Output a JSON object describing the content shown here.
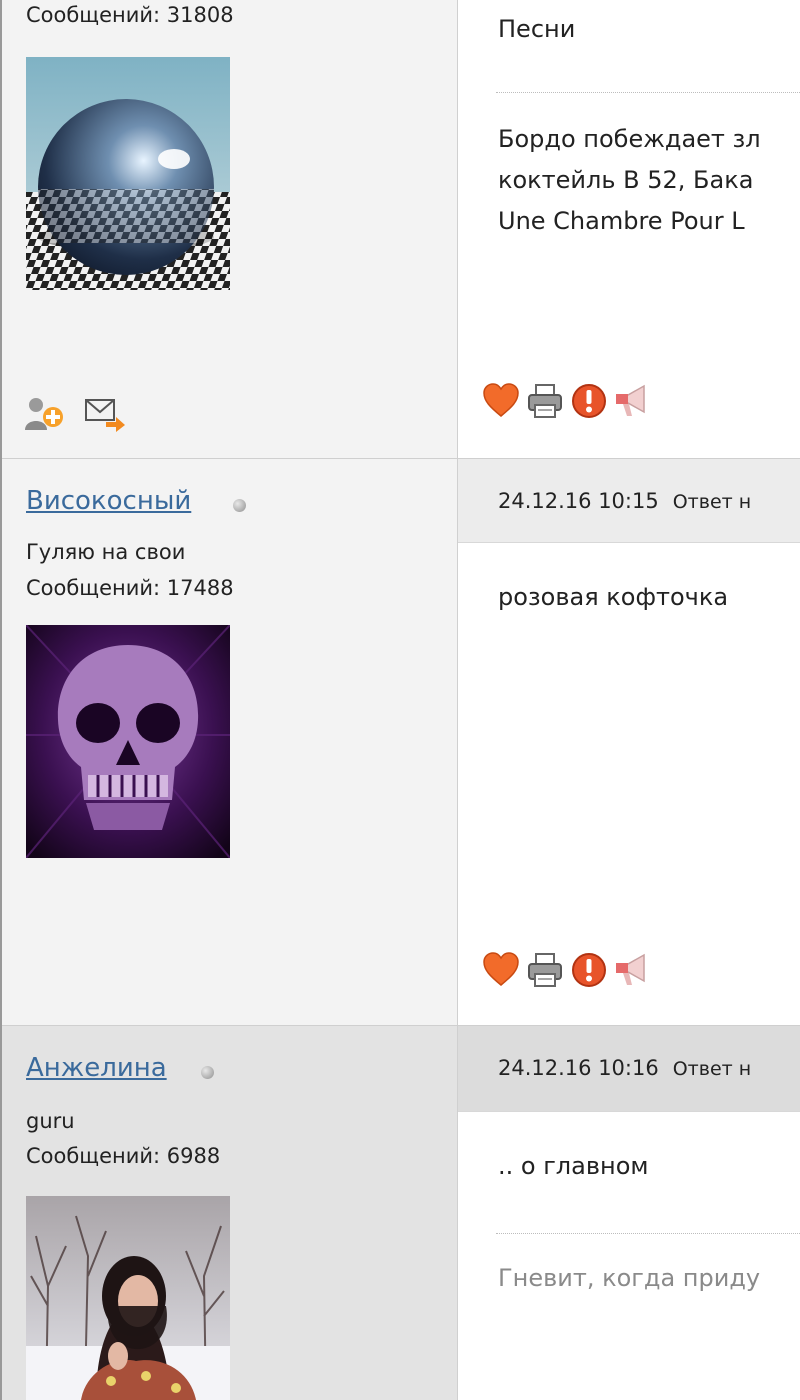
{
  "posts": [
    {
      "user_name": "",
      "messages_label": "Сообщений: 31808",
      "body": [
        "Песни"
      ],
      "signature": [
        "Бордо побеждает зл",
        "коктейль В 52, Бака",
        "Une Chambre Pour L"
      ]
    },
    {
      "user_name": "Високосный",
      "user_title": "Гуляю на свои",
      "messages_label": "Сообщений: 17488",
      "date": "24.12.16 10:15",
      "reply_label": "Ответ н",
      "body": [
        "розовая кофточка"
      ]
    },
    {
      "user_name": "Анжелина",
      "user_title": "guru",
      "messages_label": "Сообщений: 6988",
      "date": "24.12.16 10:16",
      "reply_label": "Ответ н",
      "body": [
        ".. о главном"
      ],
      "signature": [
        "Гневит, когда приду"
      ]
    }
  ],
  "icons": {
    "post_actions": [
      "heart-icon",
      "print-icon",
      "warning-icon",
      "megaphone-icon"
    ],
    "user_actions": [
      "add-friend-icon",
      "send-message-icon"
    ]
  },
  "colors": {
    "username_link": "#3a6a9c",
    "sidebar_bg": "#f3f3f3",
    "sidebar_alt_bg": "#e3e3e3",
    "header_bg": "#ececec",
    "signature_text": "#8a8a8a"
  }
}
